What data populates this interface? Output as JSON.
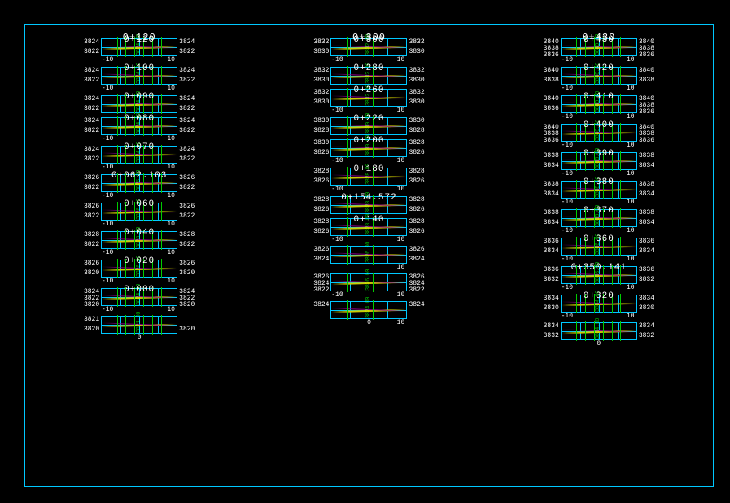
{
  "columns": [
    {
      "heading": "0+120",
      "sections": [
        {
          "station": "0+120",
          "yl": [
            "3824",
            "3822"
          ],
          "yr": [
            "3824",
            "3822"
          ],
          "xl": [
            "-10",
            "",
            "10"
          ]
        },
        {
          "station": "0+100",
          "yl": [
            "3824",
            "3822"
          ],
          "yr": [
            "3824",
            "3822"
          ],
          "xl": [
            "-10",
            "",
            "10"
          ]
        },
        {
          "station": "0+090",
          "yl": [
            "3824",
            "3822"
          ],
          "yr": [
            "3824",
            "3822"
          ],
          "xl": [
            "",
            "",
            ""
          ]
        },
        {
          "station": "0+080",
          "yl": [
            "3824",
            "3822"
          ],
          "yr": [
            "3824",
            "3822"
          ],
          "xl": [
            "-10",
            "",
            "10"
          ]
        },
        {
          "station": "0+070",
          "yl": [
            "3824",
            "3822"
          ],
          "yr": [
            "3824",
            "3822"
          ],
          "xl": [
            "-10",
            "",
            "10"
          ]
        },
        {
          "station": "0+062.103",
          "yl": [
            "3826",
            "3822"
          ],
          "yr": [
            "3826",
            "3822"
          ],
          "xl": [
            "-10",
            "",
            "10"
          ]
        },
        {
          "station": "0+060",
          "yl": [
            "3826",
            "3822"
          ],
          "yr": [
            "3826",
            "3822"
          ],
          "xl": [
            "-10",
            "",
            "10"
          ]
        },
        {
          "station": "0+040",
          "yl": [
            "3828",
            "3822"
          ],
          "yr": [
            "3828",
            "3822"
          ],
          "xl": [
            "-10",
            "",
            "10"
          ]
        },
        {
          "station": "0+020",
          "yl": [
            "3826",
            "3820"
          ],
          "yr": [
            "3826",
            "3820"
          ],
          "xl": [
            "-10",
            "",
            "10"
          ]
        },
        {
          "station": "0+000",
          "yl": [
            "3824",
            "3822",
            "3820"
          ],
          "yr": [
            "3824",
            "3822",
            "3820"
          ],
          "xl": [
            "-10",
            "",
            "10"
          ]
        },
        {
          "station": "",
          "yl": [
            "3821",
            "3820"
          ],
          "yr": [
            "",
            "3820"
          ],
          "xl": [
            "",
            "0",
            ""
          ]
        }
      ]
    },
    {
      "heading": "0+300",
      "sections": [
        {
          "station": "0+300",
          "yl": [
            "3832",
            "3830"
          ],
          "yr": [
            "3832",
            "3830"
          ],
          "xl": [
            "-10",
            "",
            "10"
          ]
        },
        {
          "station": "0+280",
          "yl": [
            "3832",
            "3830"
          ],
          "yr": [
            "3832",
            "3830"
          ],
          "xl": [
            "",
            "",
            ""
          ]
        },
        {
          "station": "0+260",
          "yl": [
            "3832",
            "3830"
          ],
          "yr": [
            "3832",
            "3830"
          ],
          "xl": [
            "-10",
            "",
            "10"
          ]
        },
        {
          "station": "0+220",
          "yl": [
            "3830",
            "3828"
          ],
          "yr": [
            "3830",
            "3828"
          ],
          "xl": [
            "",
            "",
            ""
          ]
        },
        {
          "station": "0+200",
          "yl": [
            "3830",
            "3826"
          ],
          "yr": [
            "3828",
            "3826"
          ],
          "xl": [
            "-10",
            "",
            "10"
          ]
        },
        {
          "station": "0+180",
          "yl": [
            "3828",
            "3826"
          ],
          "yr": [
            "3828",
            "3826"
          ],
          "xl": [
            "-10",
            "",
            "10"
          ]
        },
        {
          "station": "0+154.572",
          "yl": [
            "3828",
            "3826"
          ],
          "yr": [
            "3828",
            "3826"
          ],
          "xl": [
            "",
            "",
            ""
          ]
        },
        {
          "station": "0+140",
          "yl": [
            "3828",
            "3826"
          ],
          "yr": [
            "3828",
            "3826"
          ],
          "xl": [
            "-10",
            "",
            "10"
          ]
        },
        {
          "station": "",
          "yl": [
            "3826",
            "3824"
          ],
          "yr": [
            "3826",
            "3824"
          ],
          "xl": [
            "",
            "",
            "10"
          ]
        },
        {
          "station": "",
          "yl": [
            "3826",
            "3824",
            "3822"
          ],
          "yr": [
            "3826",
            "3824",
            "3822"
          ],
          "xl": [
            "-10",
            "",
            "10"
          ]
        },
        {
          "station": "",
          "yl": [
            "3824",
            ""
          ],
          "yr": [
            "3824",
            ""
          ],
          "xl": [
            "",
            "0",
            "10"
          ]
        }
      ]
    },
    {
      "heading": "0+430",
      "sections": [
        {
          "station": "0+430",
          "yl": [
            "3840",
            "3838",
            "3836"
          ],
          "yr": [
            "3840",
            "3838",
            "3836"
          ],
          "xl": [
            "-10",
            "",
            "10"
          ]
        },
        {
          "station": "0+420",
          "yl": [
            "3840",
            "3838"
          ],
          "yr": [
            "3840",
            "3838"
          ],
          "xl": [
            "-10",
            "",
            "10"
          ]
        },
        {
          "station": "0+410",
          "yl": [
            "3840",
            "3836"
          ],
          "yr": [
            "3840",
            "3838",
            "3836"
          ],
          "xl": [
            "-10",
            "",
            "10"
          ]
        },
        {
          "station": "0+400",
          "yl": [
            "3840",
            "3838",
            "3836"
          ],
          "yr": [
            "3840",
            "3838",
            "3836"
          ],
          "xl": [
            "-10",
            "",
            "10"
          ]
        },
        {
          "station": "0+390",
          "yl": [
            "3838",
            "3834"
          ],
          "yr": [
            "3838",
            "3834"
          ],
          "xl": [
            "-10",
            "",
            "10"
          ]
        },
        {
          "station": "0+380",
          "yl": [
            "3838",
            "3834"
          ],
          "yr": [
            "3838",
            "3834"
          ],
          "xl": [
            "-10",
            "",
            "10"
          ]
        },
        {
          "station": "0+370",
          "yl": [
            "3838",
            "3834"
          ],
          "yr": [
            "3838",
            "3834"
          ],
          "xl": [
            "-10",
            "",
            "10"
          ]
        },
        {
          "station": "0+360",
          "yl": [
            "3836",
            "3834"
          ],
          "yr": [
            "3836",
            "3834"
          ],
          "xl": [
            "-10",
            "",
            "10"
          ]
        },
        {
          "station": "0+350.141",
          "yl": [
            "3836",
            "3832"
          ],
          "yr": [
            "3836",
            "3832"
          ],
          "xl": [
            "-10",
            "",
            "10"
          ]
        },
        {
          "station": "0+320",
          "yl": [
            "3834",
            "3830"
          ],
          "yr": [
            "3834",
            "3830"
          ],
          "xl": [
            "-10",
            "",
            "10"
          ]
        },
        {
          "station": "",
          "yl": [
            "3834",
            "3832"
          ],
          "yr": [
            "3834",
            "3832"
          ],
          "xl": [
            "",
            "0",
            ""
          ]
        }
      ]
    }
  ],
  "xaxis_ticks": [
    "-10",
    "0",
    "10"
  ]
}
